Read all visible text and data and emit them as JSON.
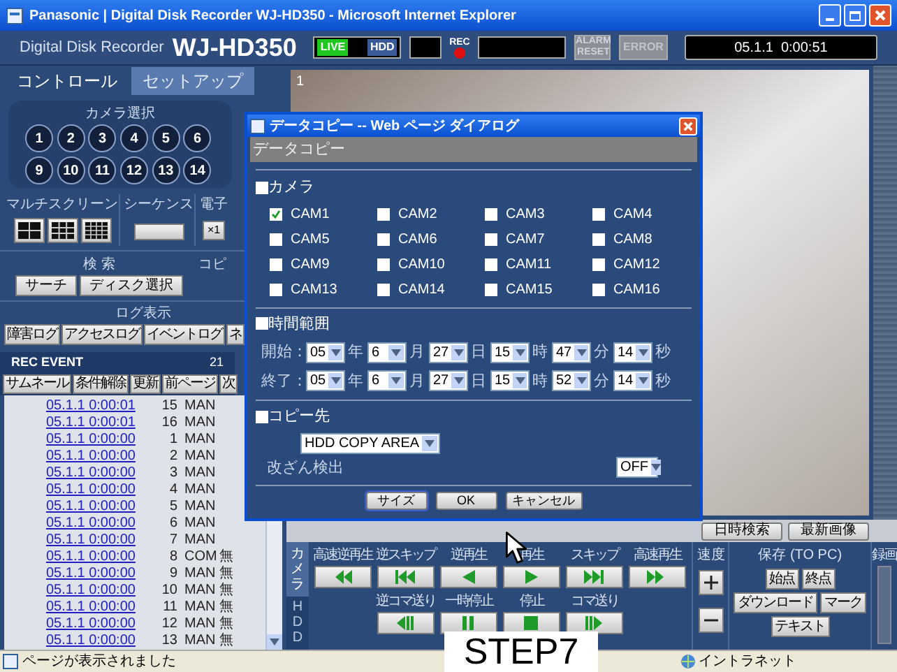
{
  "window": {
    "title": "Panasonic | Digital Disk Recorder WJ-HD350 - Microsoft Internet Explorer"
  },
  "header": {
    "subtitle": "Digital Disk Recorder",
    "model": "WJ-HD350",
    "live": "LIVE",
    "hdd": "HDD",
    "rec": "REC",
    "alarm_reset": "ALARM RESET",
    "error": "ERROR",
    "datetime": "05.1.1  0:00:51"
  },
  "tabs": [
    {
      "label": "コントロール",
      "selected": true
    },
    {
      "label": "セットアップ",
      "selected": false
    }
  ],
  "camera_select": {
    "label": "カメラ選択",
    "buttons": [
      "1",
      "2",
      "3",
      "4",
      "5",
      "6",
      "9",
      "10",
      "11",
      "12",
      "13",
      "14"
    ]
  },
  "multiscreen": {
    "label": "マルチスクリーン"
  },
  "sequence": {
    "label": "シーケンス"
  },
  "zoom": {
    "label": "電子",
    "button": "×1"
  },
  "search": {
    "label": "検 索",
    "buttons": [
      "サーチ",
      "ディスク選択"
    ],
    "copy_label": "コピ"
  },
  "log": {
    "label": "ログ表示",
    "buttons": [
      "障害ログ",
      "アクセスログ",
      "イベントログ",
      "ネ"
    ]
  },
  "rec_event": {
    "title": "REC EVENT",
    "count": "21",
    "buttons": [
      "サムネール",
      "条件解除",
      "更新",
      "前ページ",
      "次"
    ],
    "rows": [
      {
        "time": "05.1.1 0:00:01",
        "camera": "15",
        "type": "MAN"
      },
      {
        "time": "05.1.1 0:00:01",
        "camera": "16",
        "type": "MAN"
      },
      {
        "time": "05.1.1 0:00:00",
        "camera": "1",
        "type": "MAN"
      },
      {
        "time": "05.1.1 0:00:00",
        "camera": "2",
        "type": "MAN"
      },
      {
        "time": "05.1.1 0:00:00",
        "camera": "3",
        "type": "MAN"
      },
      {
        "time": "05.1.1 0:00:00",
        "camera": "4",
        "type": "MAN"
      },
      {
        "time": "05.1.1 0:00:00",
        "camera": "5",
        "type": "MAN"
      },
      {
        "time": "05.1.1 0:00:00",
        "camera": "6",
        "type": "MAN"
      },
      {
        "time": "05.1.1 0:00:00",
        "camera": "7",
        "type": "MAN"
      },
      {
        "time": "05.1.1 0:00:00",
        "camera": "8",
        "type": "COM",
        "column_4": "無"
      },
      {
        "time": "05.1.1 0:00:00",
        "camera": "9",
        "type": "MAN",
        "column_4": "無"
      },
      {
        "time": "05.1.1 0:00:00",
        "camera": "10",
        "type": "MAN",
        "column_4": "無"
      },
      {
        "time": "05.1.1 0:00:00",
        "camera": "11",
        "type": "MAN",
        "column_4": "無"
      },
      {
        "time": "05.1.1 0:00:00",
        "camera": "12",
        "type": "MAN",
        "column_4": "無"
      },
      {
        "time": "05.1.1 0:00:00",
        "camera": "13",
        "type": "MAN",
        "column_4": "無"
      }
    ]
  },
  "video": {
    "channel": "1"
  },
  "video_buttons": [
    "日時検索",
    "最新画像"
  ],
  "playback": {
    "tabs": [
      {
        "label": "カメラ",
        "selected": true
      },
      {
        "label": "HDD",
        "selected": false
      }
    ],
    "row_1": [
      {
        "label": "高速逆再生",
        "kind": "fast-reverse"
      },
      {
        "label": "逆スキップ",
        "kind": "skip-back"
      },
      {
        "label": "逆再生",
        "kind": "reverse"
      },
      {
        "label": "再生",
        "kind": "play"
      },
      {
        "label": "スキップ",
        "kind": "skip-forward"
      },
      {
        "label": "高速再生",
        "kind": "fast-forward"
      }
    ],
    "row_2": [
      {
        "label": "逆コマ送り",
        "kind": "step-back"
      },
      {
        "label": "一時停止",
        "kind": "pause"
      },
      {
        "label": "停止",
        "kind": "stop"
      },
      {
        "label": "コマ送り",
        "kind": "step-forward"
      }
    ],
    "speed": {
      "label": "速度"
    },
    "save": {
      "label": "保存 (TO PC)",
      "buttons": [
        "始点",
        "終点",
        "ダウンロード",
        "マーク",
        "テキスト"
      ]
    },
    "record": {
      "label": "録画"
    }
  },
  "dialog": {
    "title": "データコピー -- Web ページ ダイアログ",
    "heading": "データコピー",
    "camera_section": {
      "label": "カメラ",
      "cameras": [
        {
          "label": "CAM1",
          "checked": true
        },
        {
          "label": "CAM2",
          "checked": false
        },
        {
          "label": "CAM3",
          "checked": false
        },
        {
          "label": "CAM4",
          "checked": false
        },
        {
          "label": "CAM5",
          "checked": false
        },
        {
          "label": "CAM6",
          "checked": false
        },
        {
          "label": "CAM7",
          "checked": false
        },
        {
          "label": "CAM8",
          "checked": false
        },
        {
          "label": "CAM9",
          "checked": false
        },
        {
          "label": "CAM10",
          "checked": false
        },
        {
          "label": "CAM11",
          "checked": false
        },
        {
          "label": "CAM12",
          "checked": false
        },
        {
          "label": "CAM13",
          "checked": false
        },
        {
          "label": "CAM14",
          "checked": false
        },
        {
          "label": "CAM15",
          "checked": false
        },
        {
          "label": "CAM16",
          "checked": false
        }
      ]
    },
    "time_section": {
      "label": "時間範囲",
      "rows": [
        {
          "label": "開始：",
          "fields": [
            {
              "value": "05",
              "unit": "年"
            },
            {
              "value": "6",
              "unit": "月"
            },
            {
              "value": "27",
              "unit": "日"
            },
            {
              "value": "15",
              "unit": "時"
            },
            {
              "value": "47",
              "unit": "分"
            },
            {
              "value": "14",
              "unit": "秒"
            }
          ]
        },
        {
          "label": "終了：",
          "fields": [
            {
              "value": "05",
              "unit": "年"
            },
            {
              "value": "6",
              "unit": "月"
            },
            {
              "value": "27",
              "unit": "日"
            },
            {
              "value": "15",
              "unit": "時"
            },
            {
              "value": "52",
              "unit": "分"
            },
            {
              "value": "14",
              "unit": "秒"
            }
          ]
        }
      ]
    },
    "destination_section": {
      "label": "コピー先",
      "destination": "HDD COPY AREA",
      "tamper_label": "改ざん検出",
      "tamper_value": "OFF"
    },
    "buttons": [
      "サイズ",
      "OK",
      "キャンセル"
    ]
  },
  "status_bar": {
    "text": "ページが表示されました",
    "zone": "イントラネット"
  },
  "annotation": {
    "text": "STEP7"
  }
}
